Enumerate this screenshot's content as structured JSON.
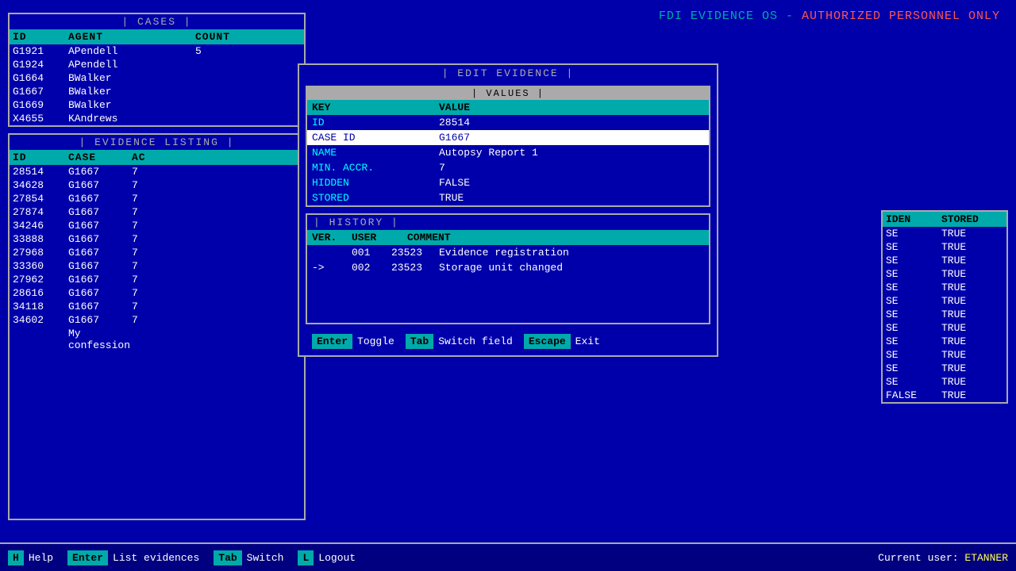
{
  "header": {
    "title": "FDI EVIDENCE OS - ",
    "authorized": "AUTHORIZED PERSONNEL ONLY"
  },
  "cases": {
    "panel_title": "| CASES |",
    "columns": [
      "ID",
      "AGENT",
      "COUNT"
    ],
    "rows": [
      {
        "id": "G1921",
        "agent": "APendell",
        "count": "5"
      },
      {
        "id": "G1924",
        "agent": "APendell",
        "count": ""
      },
      {
        "id": "G1664",
        "agent": "BWalker",
        "count": ""
      },
      {
        "id": "G1667",
        "agent": "BWalker",
        "count": ""
      },
      {
        "id": "G1669",
        "agent": "BWalker",
        "count": ""
      },
      {
        "id": "X4655",
        "agent": "KAndrews",
        "count": ""
      }
    ]
  },
  "evidence_listing": {
    "panel_title": "| EVIDENCE LISTING |",
    "columns": [
      "ID",
      "CASE",
      "AC"
    ],
    "rows": [
      {
        "id": "28514",
        "case": "G1667",
        "ac": "7"
      },
      {
        "id": "34628",
        "case": "G1667",
        "ac": "7"
      },
      {
        "id": "27854",
        "case": "G1667",
        "ac": "7"
      },
      {
        "id": "27874",
        "case": "G1667",
        "ac": "7"
      },
      {
        "id": "34246",
        "case": "G1667",
        "ac": "7"
      },
      {
        "id": "33888",
        "case": "G1667",
        "ac": "7"
      },
      {
        "id": "27968",
        "case": "G1667",
        "ac": "7"
      },
      {
        "id": "33360",
        "case": "G1667",
        "ac": "7"
      },
      {
        "id": "27962",
        "case": "G1667",
        "ac": "7"
      },
      {
        "id": "28616",
        "case": "G1667",
        "ac": "7"
      },
      {
        "id": "34118",
        "case": "G1667",
        "ac": "7"
      },
      {
        "id": "34602",
        "case": "G1667",
        "ac": "7"
      }
    ],
    "bottom_row": {
      "id": "",
      "case": "My confession",
      "ac": ""
    }
  },
  "right_partial": {
    "columns": [
      "IDEN",
      "STORED"
    ],
    "rows": [
      {
        "iden": "SE",
        "stored": "TRUE"
      },
      {
        "iden": "SE",
        "stored": "TRUE"
      },
      {
        "iden": "SE",
        "stored": "TRUE"
      },
      {
        "iden": "SE",
        "stored": "TRUE"
      },
      {
        "iden": "SE",
        "stored": "TRUE"
      },
      {
        "iden": "SE",
        "stored": "TRUE"
      },
      {
        "iden": "SE",
        "stored": "TRUE"
      },
      {
        "iden": "SE",
        "stored": "TRUE"
      },
      {
        "iden": "SE",
        "stored": "TRUE"
      },
      {
        "iden": "SE",
        "stored": "TRUE"
      },
      {
        "iden": "SE",
        "stored": "TRUE"
      },
      {
        "iden": "SE",
        "stored": "TRUE"
      }
    ],
    "bottom_row": {
      "iden": "FALSE",
      "stored": "TRUE"
    }
  },
  "edit_evidence": {
    "modal_title": "| EDIT EVIDENCE |",
    "values_title": "| VALUES |",
    "fields": [
      {
        "key": "KEY",
        "value": "VALUE",
        "header": true
      },
      {
        "key": "ID",
        "value": "28514",
        "header": false,
        "highlighted": false
      },
      {
        "key": "CASE ID",
        "value": "G1667",
        "header": false,
        "highlighted": true
      },
      {
        "key": "NAME",
        "value": "Autopsy Report 1",
        "header": false,
        "highlighted": false
      },
      {
        "key": "MIN. ACCR.",
        "value": "7",
        "header": false,
        "highlighted": false
      },
      {
        "key": "HIDDEN",
        "value": "FALSE",
        "header": false,
        "highlighted": false
      },
      {
        "key": "STORED",
        "value": "TRUE",
        "header": false,
        "highlighted": false
      }
    ],
    "history_title": "| HISTORY |",
    "history_columns": [
      "VER.",
      "USER",
      "COMMENT"
    ],
    "history_rows": [
      {
        "ver": "001",
        "user": "23523",
        "comment": "Evidence registration",
        "current": false
      },
      {
        "ver": "002",
        "user": "23523",
        "comment": "Storage unit changed",
        "current": true
      }
    ],
    "shortcuts": [
      {
        "key": "Enter",
        "label": "Toggle"
      },
      {
        "key": "Tab",
        "label": "Switch field"
      },
      {
        "key": "Escape",
        "label": "Exit"
      }
    ]
  },
  "status_bar": {
    "shortcuts": [
      {
        "key": "H",
        "label": "Help"
      },
      {
        "key": "Enter",
        "label": "List evidences"
      },
      {
        "key": "Tab",
        "label": "Switch"
      },
      {
        "key": "L",
        "label": "Logout"
      }
    ],
    "current_user_label": "Current user: ",
    "current_user": "ETANNER"
  }
}
